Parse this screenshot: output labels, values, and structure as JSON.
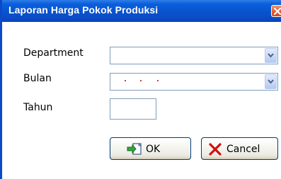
{
  "dialog": {
    "title": "Laporan Harga Pokok Produksi"
  },
  "form": {
    "department_label": "Department",
    "department_value": "",
    "bulan_label": "Bulan",
    "bulan_value": "",
    "tahun_label": "Tahun",
    "tahun_value": ""
  },
  "buttons": {
    "ok_label": "OK",
    "cancel_label": "Cancel"
  },
  "icons": {
    "close": "close-icon",
    "dropdown": "chevron-down-icon",
    "ok": "ok-document-arrow-icon",
    "cancel": "red-x-icon"
  },
  "colors": {
    "titlebar": "#0853cd",
    "close_button": "#e5603a",
    "cancel_icon": "#d01010"
  }
}
